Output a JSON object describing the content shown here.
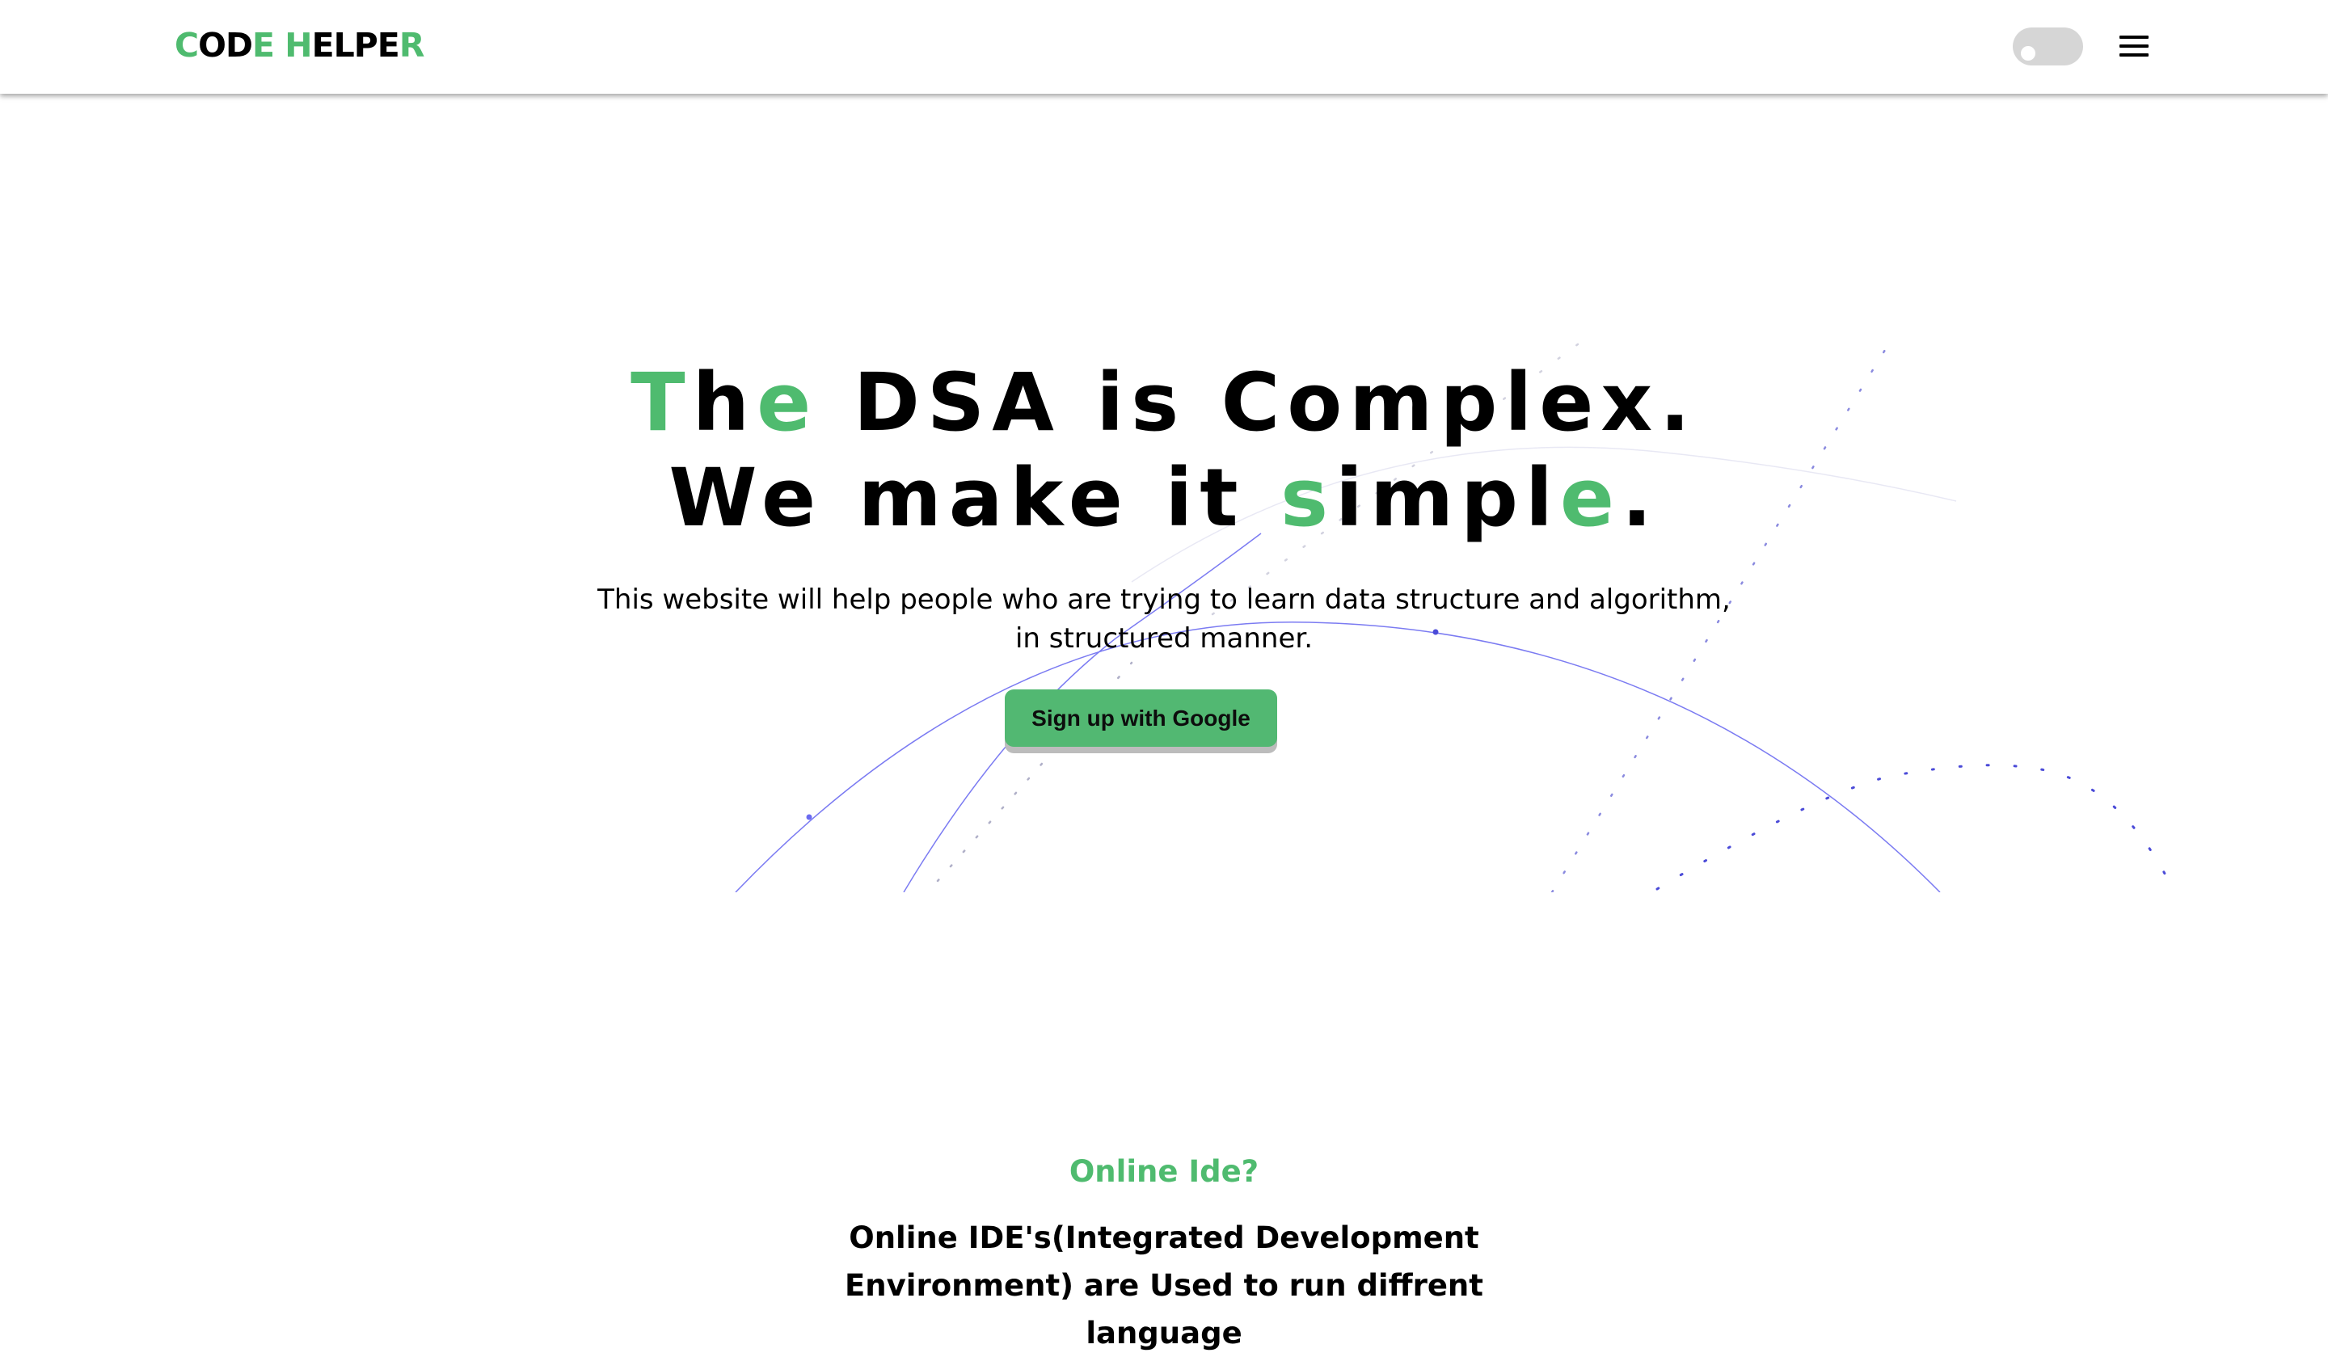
{
  "brand": {
    "logo_parts": [
      {
        "text": "C",
        "color": "green"
      },
      {
        "text": "OD",
        "color": "black"
      },
      {
        "text": "E",
        "color": "green"
      },
      {
        "text": " ",
        "color": "black"
      },
      {
        "text": "H",
        "color": "green"
      },
      {
        "text": "ELPE",
        "color": "black"
      },
      {
        "text": "R",
        "color": "green"
      }
    ]
  },
  "colors": {
    "accent": "#4fbb6f",
    "button": "#52b872",
    "toggle": "#d6d6d6",
    "curves": "#6b6bf0"
  },
  "navbar": {
    "theme_toggle_state": "off",
    "menu_icon": "hamburger-icon"
  },
  "hero": {
    "title_line1": [
      {
        "text": "T",
        "accent": true
      },
      {
        "text": "h",
        "accent": false
      },
      {
        "text": "e",
        "accent": true
      },
      {
        "text": " DSA is Complex.",
        "accent": false
      }
    ],
    "title_line2": [
      {
        "text": "We make it ",
        "accent": false
      },
      {
        "text": "s",
        "accent": true
      },
      {
        "text": "impl",
        "accent": false
      },
      {
        "text": "e",
        "accent": true
      },
      {
        "text": ".",
        "accent": false
      }
    ],
    "description_line1": "This website will help people who are trying to learn data structure and algorithm,",
    "description_line2": "in structured manner.",
    "cta_label": "Sign up with Google"
  },
  "section": {
    "label": "Online Ide?",
    "text": "Online IDE's(Integrated Development Environment) are Used to run diffrent language"
  }
}
